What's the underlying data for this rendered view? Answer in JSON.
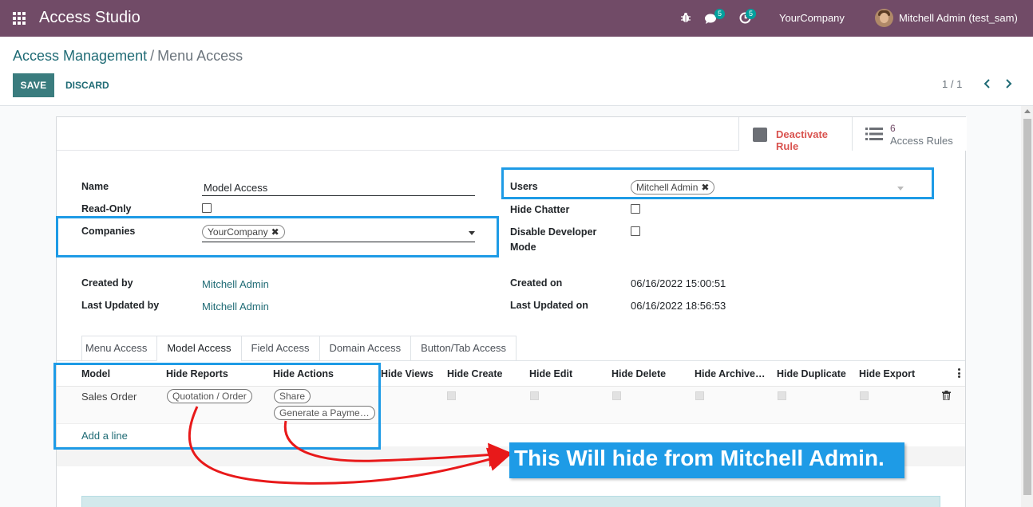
{
  "navbar": {
    "app_title": "Access Studio",
    "messages_badge": "5",
    "activities_badge": "5",
    "company": "YourCompany",
    "user": "Mitchell Admin (test_sam)"
  },
  "breadcrumb": {
    "parent": "Access Management",
    "separator": "/",
    "current": "Menu Access"
  },
  "actions": {
    "save": "SAVE",
    "discard": "DISCARD",
    "pager": "1 / 1"
  },
  "button_box": {
    "deactivate": "Deactivate Rule",
    "rules_count": "6",
    "rules_label": "Access Rules"
  },
  "form": {
    "name_label": "Name",
    "name_value": "Model Access",
    "readonly_label": "Read-Only",
    "companies_label": "Companies",
    "companies_tag": "YourCompany",
    "users_label": "Users",
    "users_tag": "Mitchell Admin",
    "hide_chatter_label": "Hide Chatter",
    "disable_dev_label_1": "Disable Developer",
    "disable_dev_label_2": "Mode",
    "created_by_label": "Created by",
    "created_by_value": "Mitchell Admin",
    "last_updated_by_label": "Last Updated by",
    "last_updated_by_value": "Mitchell Admin",
    "created_on_label": "Created on",
    "created_on_value": "06/16/2022 15:00:51",
    "last_updated_on_label": "Last Updated on",
    "last_updated_on_value": "06/16/2022 18:56:53"
  },
  "tabs": [
    "Menu Access",
    "Model Access",
    "Field Access",
    "Domain Access",
    "Button/Tab Access"
  ],
  "active_tab": "Model Access",
  "table": {
    "columns": [
      "Model",
      "Hide Reports",
      "Hide Actions",
      "Hide Views",
      "Hide Create",
      "Hide Edit",
      "Hide Delete",
      "Hide Archive…",
      "Hide Duplicate",
      "Hide Export"
    ],
    "rows": [
      {
        "model": "Sales Order",
        "hide_reports": [
          "Quotation / Order"
        ],
        "hide_actions": [
          "Share",
          "Generate a Payme…"
        ]
      }
    ],
    "add_line": "Add a line"
  },
  "annotation": {
    "callout": "This Will hide from Mitchell Admin."
  },
  "colors": {
    "navbar": "#714b67",
    "primary": "#3a7c7e",
    "link": "#1f6b75",
    "highlight": "#1e9be6",
    "arrow": "#e8191a",
    "danger": "#d9534f"
  }
}
